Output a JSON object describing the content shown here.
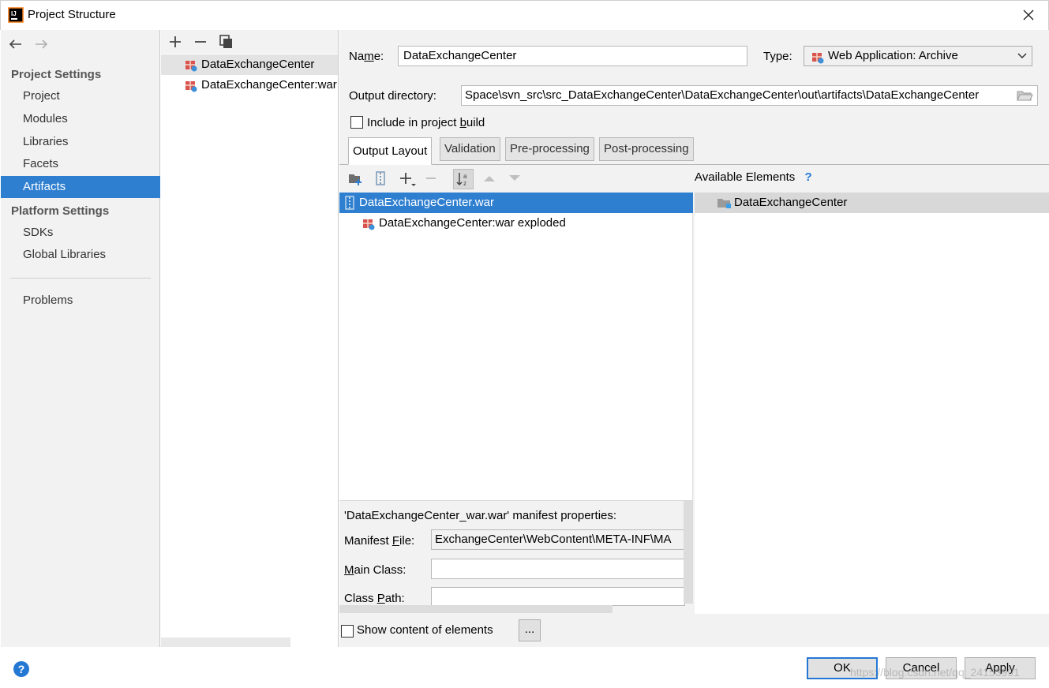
{
  "window": {
    "title": "Project Structure",
    "icon": "intellij-app-icon",
    "close_icon": "close-icon"
  },
  "nav": {
    "back_icon": "back-arrow-icon",
    "forward_icon": "forward-arrow-icon",
    "project_settings_header": "Project Settings",
    "project_settings_items": [
      "Project",
      "Modules",
      "Libraries",
      "Facets",
      "Artifacts"
    ],
    "platform_settings_header": "Platform Settings",
    "platform_settings_items": [
      "SDKs",
      "Global Libraries"
    ],
    "problems": "Problems",
    "selected": "Artifacts",
    "selected_color": "#2f7fd0"
  },
  "artifacts": {
    "toolbar_icons": [
      "add-icon",
      "remove-icon",
      "copy-icon"
    ],
    "items": [
      "DataExchangeCenter",
      "DataExchangeCenter:war exploded"
    ],
    "selected_index": 0
  },
  "detail": {
    "name_label": "Name:",
    "name_value": "DataExchangeCenter",
    "type_label": "Type:",
    "type_value": "Web Application: Archive",
    "output_dir_label": "Output directory:",
    "output_dir_value": "Space\\svn_src\\src_DataExchangeCenter\\DataExchangeCenter\\out\\artifacts\\DataExchangeCenter",
    "include_build_label_pre": "Include in project ",
    "include_build_label_ul": "b",
    "include_build_label_post": "uild",
    "include_build_checked": false,
    "tabs": [
      "Output Layout",
      "Validation",
      "Pre-processing",
      "Post-processing"
    ],
    "active_tab": "Output Layout"
  },
  "layout": {
    "toolbar_icons": [
      "new-folder-icon",
      "archive-icon",
      "add-icon",
      "remove-icon",
      "sort-az-icon",
      "move-up-icon",
      "move-down-icon"
    ],
    "tree": [
      "DataExchangeCenter.war",
      "DataExchangeCenter:war exploded"
    ],
    "available_header": "Available Elements",
    "available_help": "?",
    "available_items": [
      "DataExchangeCenter"
    ]
  },
  "manifest": {
    "title": "'DataExchangeCenter_war.war' manifest properties:",
    "file_label_pre": "Manifest ",
    "file_label_ul": "F",
    "file_label_post": "ile:",
    "file_value": "ExchangeCenter\\WebContent\\META-INF\\MA",
    "main_class_label_ul": "M",
    "main_class_label_post": "ain Class:",
    "main_class_value": "",
    "class_path_label_pre": "Class ",
    "class_path_label_ul": "P",
    "class_path_label_post": "ath:",
    "class_path_value": ""
  },
  "footer": {
    "show_content_label": "Show content of elements",
    "show_content_checked": false,
    "more_button": "...",
    "help": "?",
    "ok": "OK",
    "cancel": "Cancel",
    "apply": "Apply",
    "watermark": "https://blog.csdn.net/qq_24153991"
  }
}
